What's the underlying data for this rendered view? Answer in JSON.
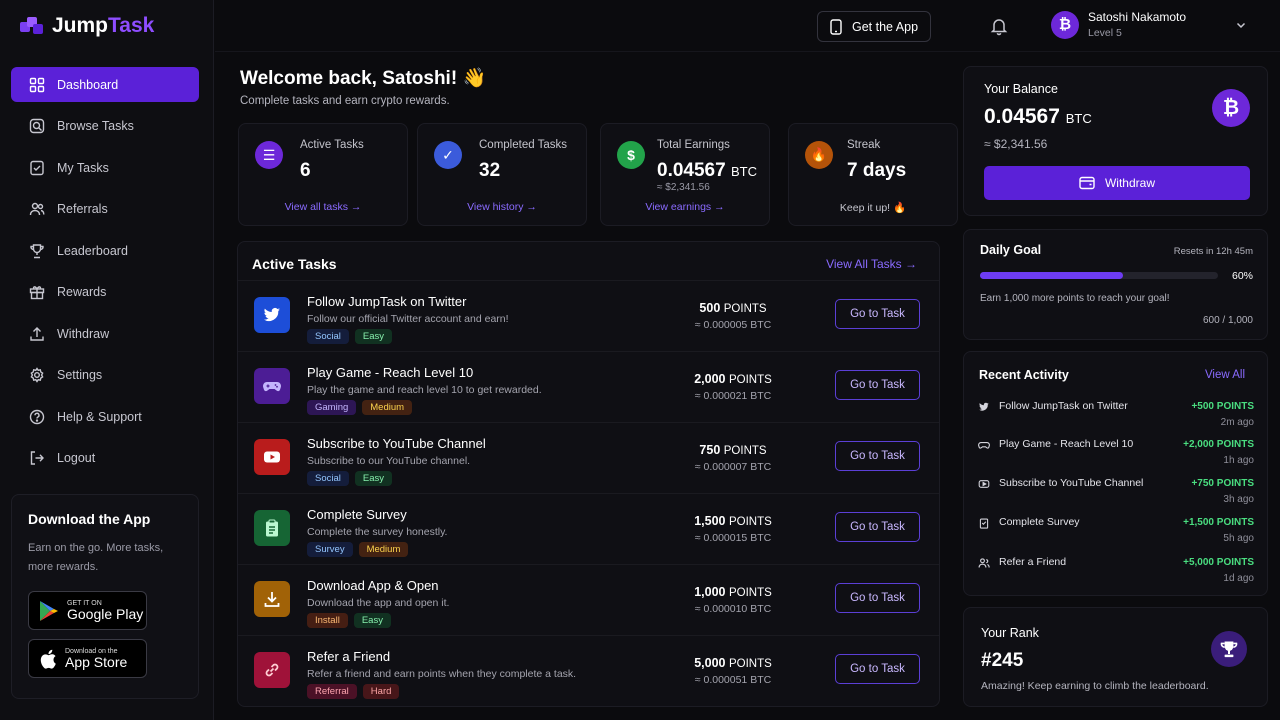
{
  "brand": {
    "name_a": "Jump",
    "name_b": "Task",
    "accent": "#5b21d8"
  },
  "sidebar": {
    "items": [
      {
        "label": "Dashboard",
        "icon": "grid-icon",
        "active": true
      },
      {
        "label": "Browse Tasks",
        "icon": "search-icon"
      },
      {
        "label": "My Tasks",
        "icon": "checklist-icon"
      },
      {
        "label": "Referrals",
        "icon": "users-icon"
      },
      {
        "label": "Leaderboard",
        "icon": "trophy-icon"
      },
      {
        "label": "Rewards",
        "icon": "gift-icon"
      },
      {
        "label": "Withdraw",
        "icon": "upload-icon"
      },
      {
        "label": "Settings",
        "icon": "gear-icon"
      },
      {
        "label": "Help & Support",
        "icon": "help-icon"
      },
      {
        "label": "Logout",
        "icon": "logout-icon"
      }
    ],
    "download": {
      "title": "Download the App",
      "text": "Earn on the go. More tasks, more rewards.",
      "google": {
        "small": "GET IT ON",
        "big": "Google Play"
      },
      "apple": {
        "small": "Download on the",
        "big": "App Store"
      }
    }
  },
  "topbar": {
    "get_app": "Get the App",
    "user": {
      "name": "Satoshi Nakamoto",
      "level": "Level 5",
      "avatar_symbol": "₿"
    }
  },
  "welcome": {
    "title": "Welcome back, Satoshi! 👋",
    "subtitle": "Complete tasks and earn crypto rewards."
  },
  "stats": [
    {
      "label": "Active Tasks",
      "value": "6",
      "unit": "",
      "sub": "",
      "link": "View all tasks  →",
      "color": "#6d28d9",
      "symbol": "☰"
    },
    {
      "label": "Completed Tasks",
      "value": "32",
      "unit": "",
      "sub": "",
      "link": "View history  →",
      "color": "#3b5bdb",
      "symbol": "✓"
    },
    {
      "label": "Total Earnings",
      "value": "0.04567",
      "unit": "BTC",
      "sub": "≈ $2,341.56",
      "link": "View earnings  →",
      "color": "#22a34a",
      "symbol": "$"
    },
    {
      "label": "Streak",
      "value": "7 days",
      "unit": "",
      "sub": "",
      "link": "Keep it up! 🔥",
      "color": "#b45309",
      "symbol": "🔥"
    }
  ],
  "tasks_panel": {
    "title": "Active Tasks",
    "view_all": "View All Tasks  →",
    "button_label": "Go to Task",
    "points_unit": "POINTS",
    "tasks": [
      {
        "title": "Follow JumpTask on Twitter",
        "desc": "Follow our official Twitter account and earn!",
        "tags": [
          "Social",
          "Easy"
        ],
        "points": "500",
        "btc": "≈ 0.000005 BTC",
        "icon": "twitter-icon",
        "bg": "#1d4ed8"
      },
      {
        "title": "Play Game - Reach Level 10",
        "desc": "Play the game and reach level 10 to get rewarded.",
        "tags": [
          "Gaming",
          "Medium"
        ],
        "points": "2,000",
        "btc": "≈ 0.000021 BTC",
        "icon": "gamepad-icon",
        "bg": "#4c1d95"
      },
      {
        "title": "Subscribe to YouTube Channel",
        "desc": "Subscribe to our YouTube channel.",
        "tags": [
          "Social",
          "Easy"
        ],
        "points": "750",
        "btc": "≈ 0.000007 BTC",
        "icon": "youtube-icon",
        "bg": "#b91c1c"
      },
      {
        "title": "Complete Survey",
        "desc": "Complete the survey honestly.",
        "tags": [
          "Survey",
          "Medium"
        ],
        "points": "1,500",
        "btc": "≈ 0.000015 BTC",
        "icon": "clipboard-icon",
        "bg": "#166534"
      },
      {
        "title": "Download App & Open",
        "desc": "Download the app and open it.",
        "tags": [
          "Install",
          "Easy"
        ],
        "points": "1,000",
        "btc": "≈ 0.000010 BTC",
        "icon": "download-icon",
        "bg": "#a16207"
      },
      {
        "title": "Refer a Friend",
        "desc": "Refer a friend and earn points when they complete a task.",
        "tags": [
          "Referral",
          "Hard"
        ],
        "points": "5,000",
        "btc": "≈ 0.000051 BTC",
        "icon": "link-icon",
        "bg": "#9f1239"
      }
    ]
  },
  "balance": {
    "label": "Your Balance",
    "value": "0.04567",
    "unit": "BTC",
    "usd": "≈ $2,341.56",
    "withdraw": "Withdraw",
    "symbol": "₿"
  },
  "daily_goal": {
    "title": "Daily Goal",
    "resets": "Resets in 12h 45m",
    "progress": 0.6,
    "pct": "60%",
    "message": "Earn 1,000 more points to reach your goal!",
    "count": "600 / 1,000"
  },
  "activity": {
    "title": "Recent Activity",
    "view_all": "View All",
    "items": [
      {
        "name": "Follow JumpTask on Twitter",
        "points": "+500 POINTS",
        "time": "2m ago",
        "icon": "twitter-icon"
      },
      {
        "name": "Play Game - Reach Level 10",
        "points": "+2,000 POINTS",
        "time": "1h ago",
        "icon": "gamepad-icon"
      },
      {
        "name": "Subscribe to YouTube Channel",
        "points": "+750 POINTS",
        "time": "3h ago",
        "icon": "youtube-icon"
      },
      {
        "name": "Complete Survey",
        "points": "+1,500 POINTS",
        "time": "5h ago",
        "icon": "clipboard-icon"
      },
      {
        "name": "Refer a Friend",
        "points": "+5,000 POINTS",
        "time": "1d ago",
        "icon": "users-icon"
      }
    ]
  },
  "rank": {
    "label": "Your Rank",
    "value": "#245",
    "message": "Amazing! Keep earning to climb the leaderboard."
  }
}
